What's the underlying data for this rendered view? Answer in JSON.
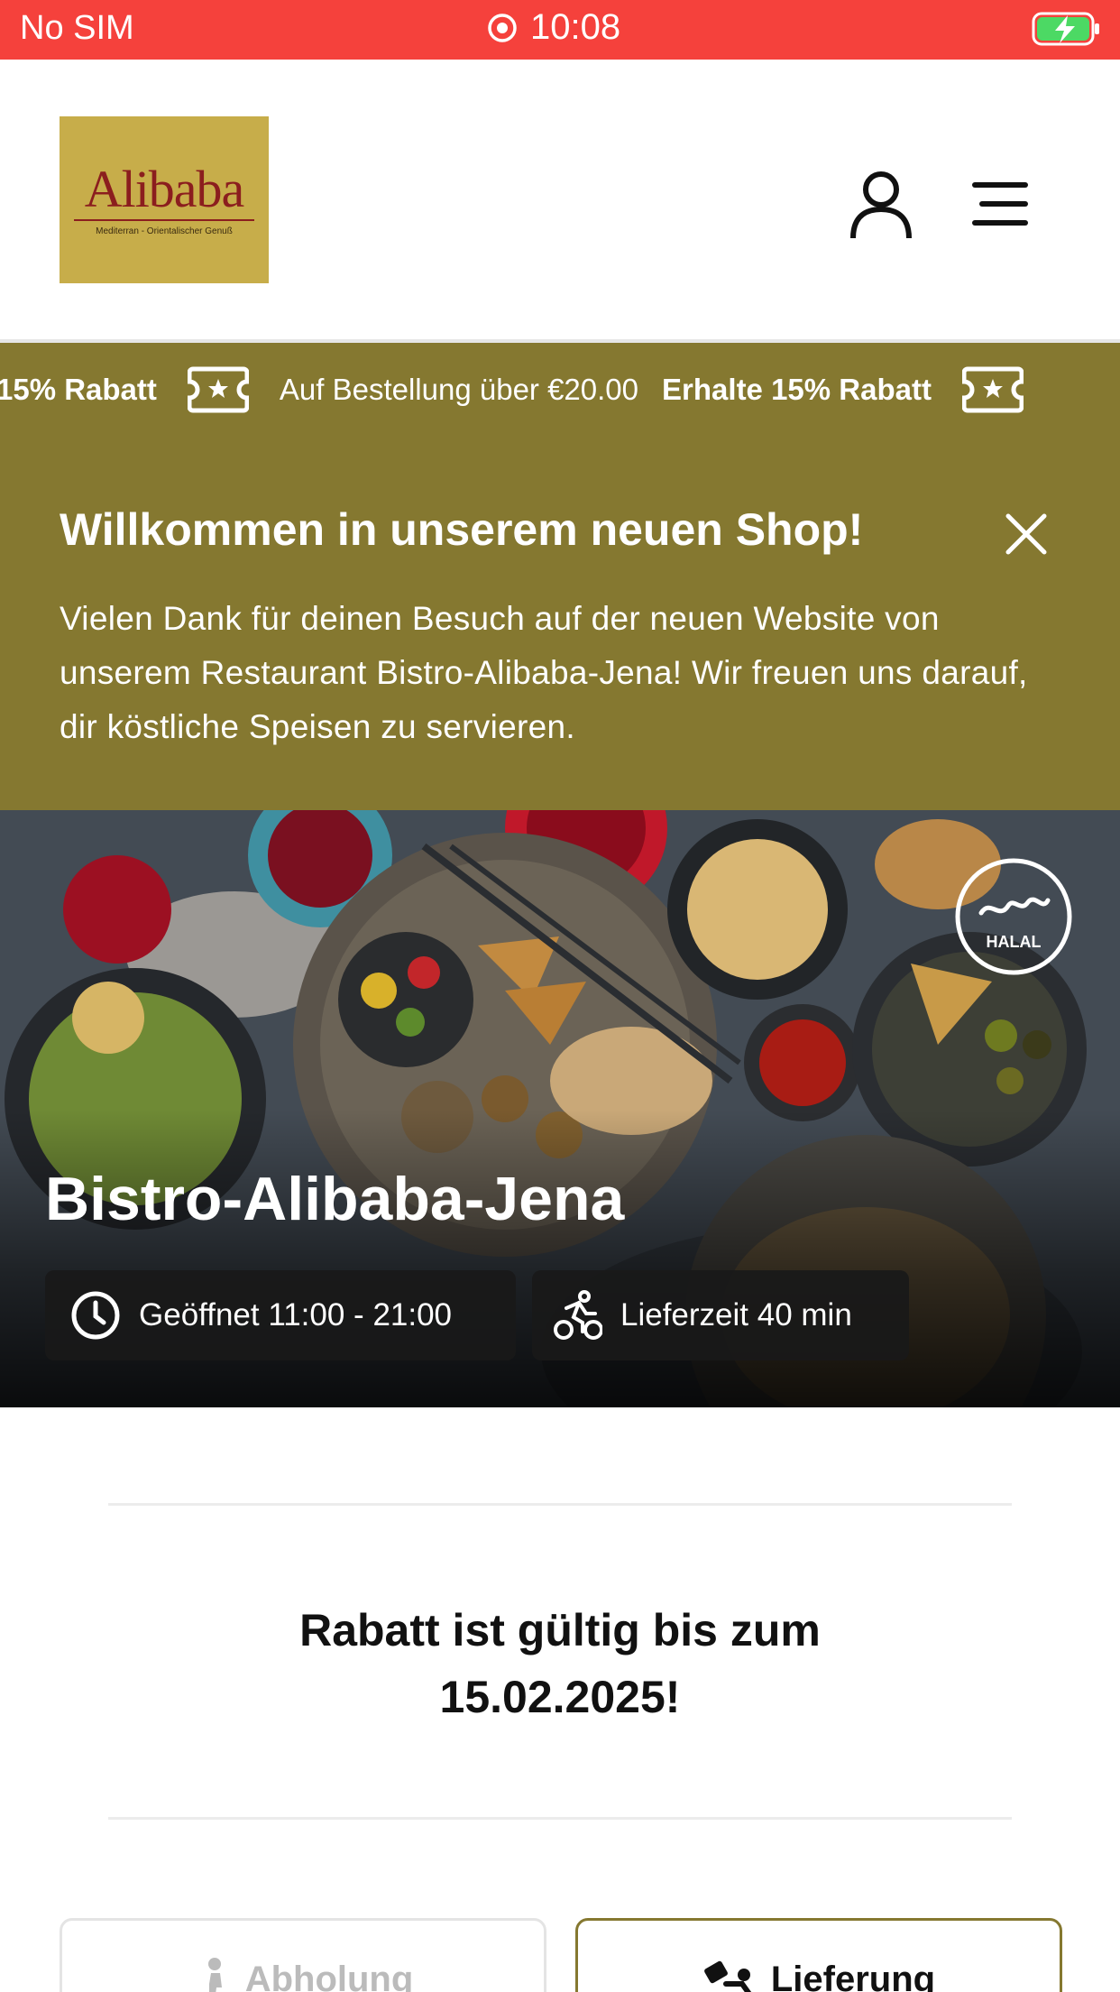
{
  "status_bar": {
    "carrier": "No SIM",
    "time": "10:08"
  },
  "header": {
    "logo_text": "Alibaba",
    "logo_tagline": "Mediterran - Orientalischer Genuß"
  },
  "promo_ticker": {
    "items": [
      {
        "text": "15% Rabatt",
        "bold": true
      },
      {
        "text": "Auf Bestellung über €20.00",
        "bold": false
      },
      {
        "text": "Erhalte 15% Rabatt",
        "bold": true
      }
    ]
  },
  "welcome": {
    "title": "Willkommen in unserem neuen Shop!",
    "body": "Vielen Dank für deinen Besuch auf der neuen Website von unserem Restaurant Bistro-Alibaba-Jena! Wir freuen uns darauf, dir köstliche Speisen zu servieren."
  },
  "hero": {
    "restaurant_name": "Bistro-Alibaba-Jena",
    "halal_label": "HALAL",
    "opening_hours": "Geöffnet 11:00 - 21:00",
    "delivery_time": "Lieferzeit 40 min"
  },
  "discount_notice": {
    "line1": "Rabatt ist gültig bis zum",
    "line2": "15.02.2025!"
  },
  "order_mode": {
    "pickup_label": "Abholung",
    "delivery_label": "Lieferung",
    "selected": "delivery"
  },
  "colors": {
    "status_bar": "#f5413c",
    "brand_olive": "#857830",
    "logo_gold": "#c7ad4a",
    "logo_red": "#8b1e1e"
  }
}
